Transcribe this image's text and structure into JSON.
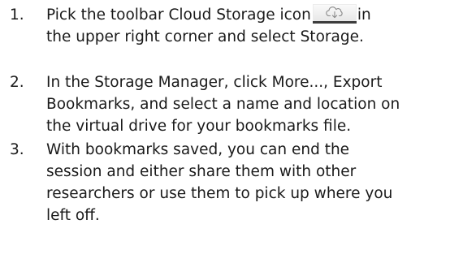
{
  "steps": [
    {
      "number": "1.",
      "line1_before": "Pick the toolbar Cloud Storage icon",
      "line1_after": "in",
      "line2": "the upper right corner and select Storage.",
      "icon": "cloud-storage-icon"
    },
    {
      "number": "2.",
      "lines": [
        "In the Storage Manager, click More..., Export",
        "Bookmarks, and select a name and location on",
        "the virtual drive for your bookmarks file."
      ]
    },
    {
      "number": "3.",
      "lines": [
        "With bookmarks saved, you can end the",
        "session and either share them with other",
        "researchers or use them to pick up where you",
        "left off."
      ]
    }
  ]
}
